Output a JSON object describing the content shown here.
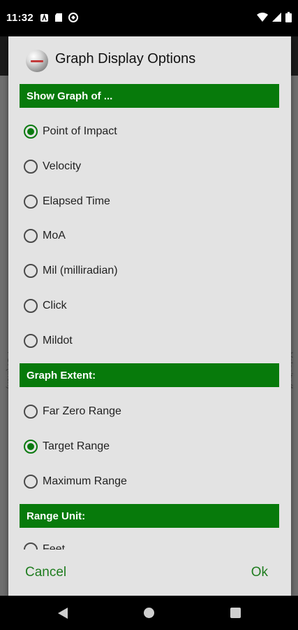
{
  "status_bar": {
    "time": "11:32"
  },
  "background": {
    "left_axis_text": "POI (inch)",
    "right_axis_text": "Velocity (f"
  },
  "dialog": {
    "title": "Graph Display Options",
    "sections": [
      {
        "header": "Show Graph of ...",
        "options": [
          {
            "label": "Point of Impact",
            "checked": true
          },
          {
            "label": "Velocity",
            "checked": false
          },
          {
            "label": "Elapsed Time",
            "checked": false
          },
          {
            "label": "MoA",
            "checked": false
          },
          {
            "label": "Mil (milliradian)",
            "checked": false
          },
          {
            "label": "Click",
            "checked": false
          },
          {
            "label": "Mildot",
            "checked": false
          }
        ]
      },
      {
        "header": "Graph Extent:",
        "options": [
          {
            "label": "Far Zero Range",
            "checked": false
          },
          {
            "label": "Target Range",
            "checked": true
          },
          {
            "label": "Maximum Range",
            "checked": false
          }
        ]
      },
      {
        "header": "Range Unit:",
        "options": [
          {
            "label": "Feet",
            "checked": false
          }
        ]
      }
    ],
    "cancel_label": "Cancel",
    "ok_label": "Ok"
  },
  "colors": {
    "section_header_bg": "#077a0b",
    "accent_green": "#0a7a10",
    "button_text": "#1f7d1f"
  }
}
